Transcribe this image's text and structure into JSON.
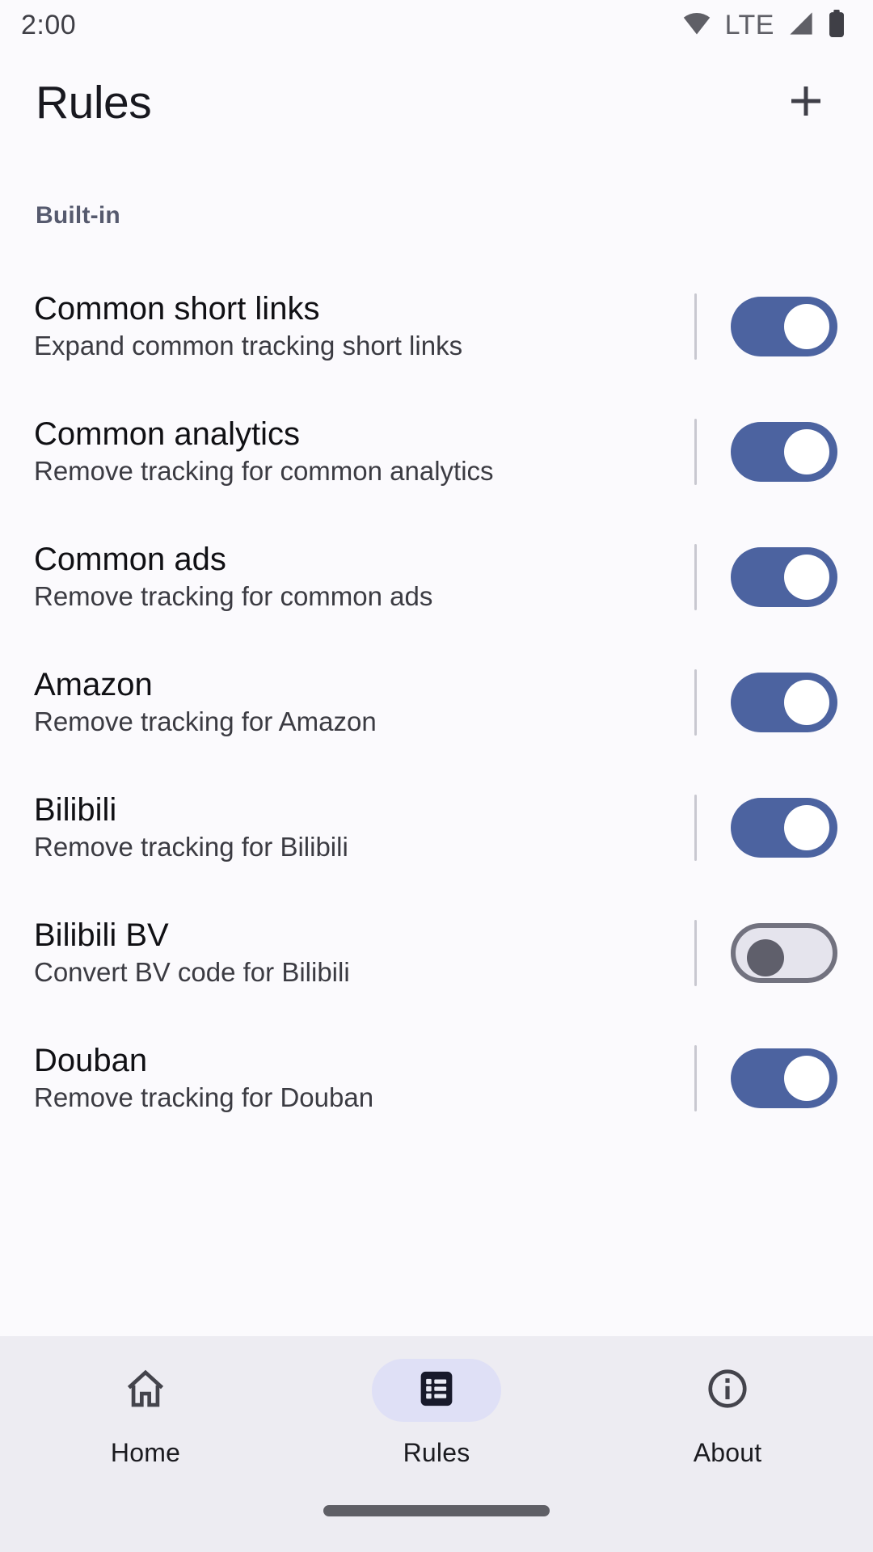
{
  "status_bar": {
    "time": "2:00",
    "network_label": "LTE",
    "icons": [
      "wifi-icon",
      "signal-icon",
      "battery-icon"
    ]
  },
  "app_bar": {
    "title": "Rules",
    "add_button_label": "+",
    "add_button_name": "add-rule-button"
  },
  "sections": [
    {
      "header": "Built-in",
      "rows": [
        {
          "title": "Common short links",
          "subtitle": "Expand common tracking short links",
          "enabled": true
        },
        {
          "title": "Common analytics",
          "subtitle": "Remove tracking for common analytics",
          "enabled": true
        },
        {
          "title": "Common ads",
          "subtitle": "Remove tracking for common ads",
          "enabled": true
        },
        {
          "title": "Amazon",
          "subtitle": "Remove tracking for Amazon",
          "enabled": true
        },
        {
          "title": "Bilibili",
          "subtitle": "Remove tracking for Bilibili",
          "enabled": true
        },
        {
          "title": "Bilibili BV",
          "subtitle": "Convert BV code for Bilibili",
          "enabled": false
        },
        {
          "title": "Douban",
          "subtitle": "Remove tracking for Douban",
          "enabled": true
        }
      ]
    }
  ],
  "bottom_nav": {
    "items": [
      {
        "label": "Home",
        "icon": "home-icon",
        "active": false
      },
      {
        "label": "Rules",
        "icon": "list-icon",
        "active": true
      },
      {
        "label": "About",
        "icon": "info-icon",
        "active": false
      }
    ]
  },
  "colors": {
    "background": "#fbfafd",
    "switch_on_track": "#4c63a0",
    "switch_off_track": "#e5e4ed",
    "switch_off_border": "#72727f",
    "nav_background": "#edecf2",
    "nav_active_pill": "#dfe0f6",
    "section_header": "#565a6e",
    "title_text": "#101014",
    "subtitle_text": "#3b3b42"
  }
}
